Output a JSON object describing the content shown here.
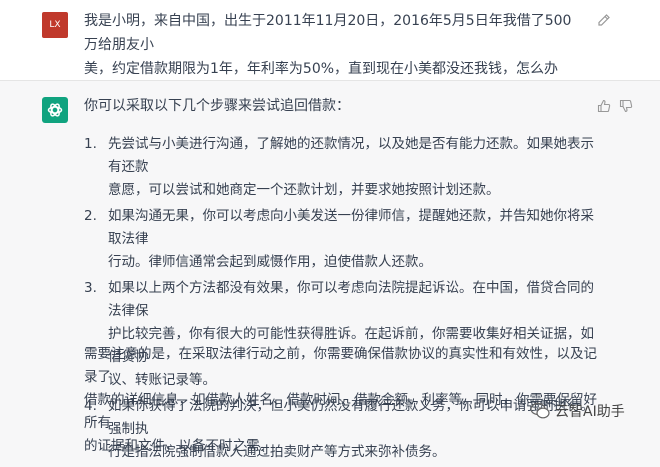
{
  "user": {
    "avatar_initials": "LX",
    "message_line1": "我是小明，来自中国，出生于2011年11月20日，2016年5月5日年我借了500万给朋友小",
    "message_line2": "美，约定借款期限为1年，年利率为50%，直到现在小美都没还我钱，怎么办"
  },
  "assistant": {
    "intro": "你可以采取以下几个步骤来尝试追回借款：",
    "steps": [
      {
        "num": "1.",
        "line1": "先尝试与小美进行沟通，了解她的还款情况，以及她是否有能力还款。如果她表示有还款",
        "line2": "意愿，可以尝试和她商定一个还款计划，并要求她按照计划还款。"
      },
      {
        "num": "2.",
        "line1": "如果沟通无果，你可以考虑向小美发送一份律师信，提醒她还款，并告知她你将采取法律",
        "line2": "行动。律师信通常会起到威慑作用，迫使借款人还款。"
      },
      {
        "num": "3.",
        "line1": "如果以上两个方法都没有效果，你可以考虑向法院提起诉讼。在中国，借贷合同的法律保",
        "line2": "护比较完善，你有很大的可能性获得胜诉。在起诉前，你需要收集好相关证据，如借贷协",
        "line3": "议、转账记录等。"
      },
      {
        "num": "4.",
        "line1": "如果你获得了法院的判决，但小美仍然没有履行还款义务，你可以申请强制执行。强制执",
        "line2": "行是指法院强制借款人通过拍卖财产等方式来弥补债务。"
      }
    ],
    "note_line1": "需要注意的是，在采取法律行动之前，你需要确保借款协议的真实性和有效性，以及记录了",
    "note_line2": "借款的详细信息，如借款人姓名、借款时间、借款金额、利率等。同时，你需要保留好所有",
    "note_line3": "的证据和文件，以备不时之需。"
  },
  "watermark": {
    "text": "云智AI助手"
  },
  "colors": {
    "user_avatar": "#c0392b",
    "bot_avatar": "#10a37f",
    "assistant_bg": "#f7f7f8"
  }
}
